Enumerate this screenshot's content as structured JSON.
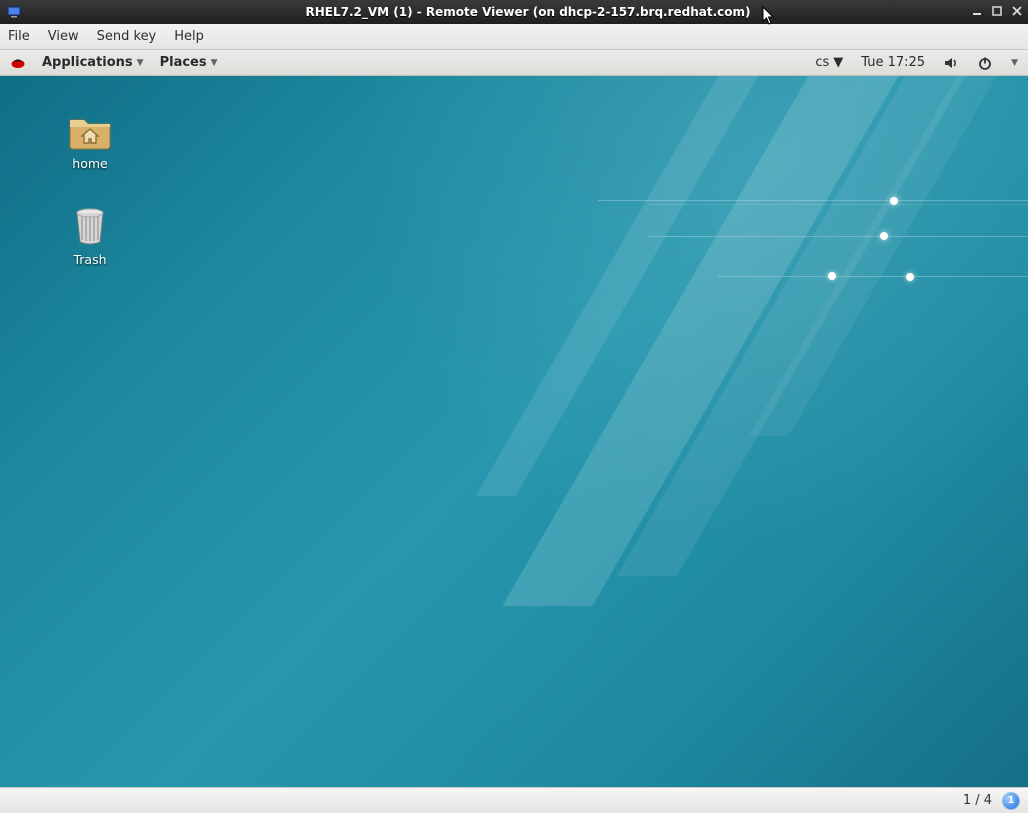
{
  "titlebar": {
    "title": "RHEL7.2_VM (1) - Remote Viewer (on dhcp-2-157.brq.redhat.com)"
  },
  "menubar": {
    "file": "File",
    "view": "View",
    "sendkey": "Send key",
    "help": "Help"
  },
  "panel": {
    "applications": "Applications",
    "places": "Places",
    "lang": "cs",
    "clock": "Tue 17:25"
  },
  "desktop": {
    "home": "home",
    "trash": "Trash"
  },
  "statusbar": {
    "pager": "1 / 4",
    "badge": "1"
  }
}
